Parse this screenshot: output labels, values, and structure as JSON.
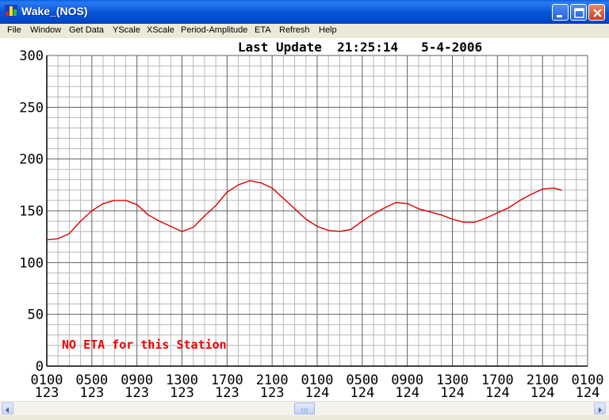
{
  "window": {
    "title": "Wake_(NOS)"
  },
  "menu": {
    "items": [
      {
        "id": "file",
        "label": "File"
      },
      {
        "id": "window",
        "label": "Window"
      },
      {
        "id": "get-data",
        "label": "Get Data"
      },
      {
        "id": "yscale",
        "label": "YScale"
      },
      {
        "id": "xscale",
        "label": "XScale"
      },
      {
        "id": "period-amplitude",
        "label": "Period-Amplitude"
      },
      {
        "id": "eta",
        "label": "ETA"
      },
      {
        "id": "refresh",
        "label": "Refresh"
      },
      {
        "id": "help",
        "label": "Help"
      }
    ]
  },
  "header": {
    "last_update": "Last Update  21:25:14   5-4-2006"
  },
  "annotation": {
    "no_eta": "NO ETA for this Station"
  },
  "colors": {
    "series": "#dd0000",
    "annotation": "#ee0000",
    "title_bar": "#0a5fe0"
  },
  "chart_data": {
    "type": "line",
    "title": "Last Update  21:25:14   5-4-2006",
    "xlabel": "",
    "ylabel": "",
    "ylim": [
      0,
      300
    ],
    "yticks": [
      0,
      50,
      100,
      150,
      200,
      250,
      300
    ],
    "grid": true,
    "x_units": "hours",
    "xlim": [
      0,
      48
    ],
    "xtick_values": [
      0,
      4,
      8,
      12,
      16,
      20,
      24,
      28,
      32,
      36,
      40,
      44,
      48
    ],
    "xticks": [
      {
        "time": "0100",
        "day": "123"
      },
      {
        "time": "0500",
        "day": "123"
      },
      {
        "time": "0900",
        "day": "123"
      },
      {
        "time": "1300",
        "day": "123"
      },
      {
        "time": "1700",
        "day": "123"
      },
      {
        "time": "2100",
        "day": "123"
      },
      {
        "time": "0100",
        "day": "124"
      },
      {
        "time": "0500",
        "day": "124"
      },
      {
        "time": "0900",
        "day": "124"
      },
      {
        "time": "1300",
        "day": "124"
      },
      {
        "time": "1700",
        "day": "124"
      },
      {
        "time": "2100",
        "day": "124"
      },
      {
        "time": "0100",
        "day": "124"
      }
    ],
    "series": [
      {
        "values": [
          [
            0,
            122
          ],
          [
            1,
            123
          ],
          [
            2,
            128
          ],
          [
            3,
            140
          ],
          [
            4,
            150
          ],
          [
            5,
            157
          ],
          [
            6,
            160
          ],
          [
            7,
            160
          ],
          [
            8,
            156
          ],
          [
            9,
            146
          ],
          [
            10,
            140
          ],
          [
            11,
            135
          ],
          [
            12,
            130
          ],
          [
            13,
            134
          ],
          [
            14,
            145
          ],
          [
            15,
            155
          ],
          [
            16,
            168
          ],
          [
            17,
            175
          ],
          [
            18,
            179
          ],
          [
            19,
            177
          ],
          [
            20,
            172
          ],
          [
            21,
            162
          ],
          [
            22,
            152
          ],
          [
            23,
            142
          ],
          [
            24,
            135
          ],
          [
            25,
            131
          ],
          [
            26,
            130
          ],
          [
            27,
            132
          ],
          [
            28,
            140
          ],
          [
            29,
            147
          ],
          [
            30,
            153
          ],
          [
            31,
            158
          ],
          [
            32,
            157
          ],
          [
            33,
            152
          ],
          [
            34,
            149
          ],
          [
            35,
            146
          ],
          [
            36,
            142
          ],
          [
            37,
            139
          ],
          [
            38,
            139
          ],
          [
            39,
            143
          ],
          [
            40,
            148
          ],
          [
            41,
            153
          ],
          [
            42,
            160
          ],
          [
            43,
            166
          ],
          [
            44,
            171
          ],
          [
            45,
            172
          ],
          [
            45.7,
            170
          ]
        ]
      }
    ]
  }
}
